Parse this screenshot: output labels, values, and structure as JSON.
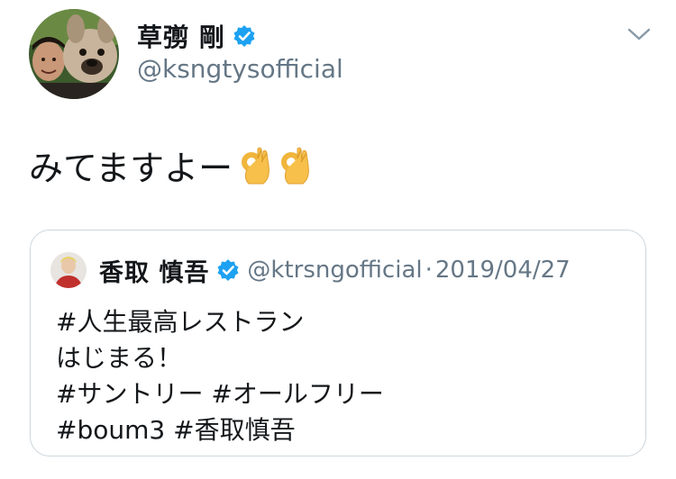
{
  "author": {
    "display_name": "草彅 剛",
    "handle": "@ksngtysofficial",
    "verified": true
  },
  "tweet": {
    "text": "みてますよー",
    "emojis": [
      "ok-hand-icon",
      "ok-hand-icon"
    ]
  },
  "quoted_tweet": {
    "author": {
      "display_name": "香取 慎吾",
      "handle": "@ktrsngofficial",
      "verified": true
    },
    "separator": "·",
    "date": "2019/04/27",
    "lines": [
      "#人生最高レストラン",
      "はじまる！",
      "#サントリー #オールフリー",
      "#boum3 #香取慎吾"
    ]
  },
  "colors": {
    "verified_blue": "#1da1f2",
    "secondary_text": "#657786",
    "border": "#ccd6dd"
  }
}
